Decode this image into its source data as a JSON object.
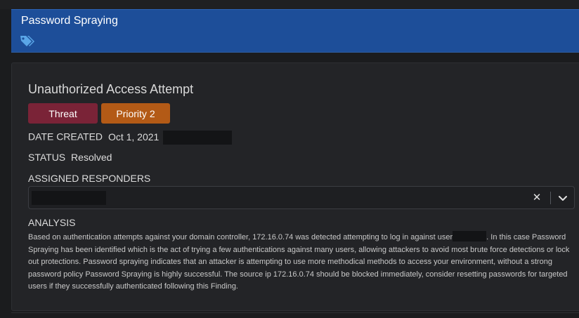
{
  "header": {
    "title": "Password Spraying",
    "tags_icon": "tags-icon",
    "color": "#1d4e99"
  },
  "finding": {
    "title": "Unauthorized Access Attempt",
    "badges": {
      "threat": "Threat",
      "priority": "Priority 2"
    },
    "date_created_label": "DATE CREATED",
    "date_created_value": "Oct 1, 2021",
    "status_label": "STATUS",
    "status_value": "Resolved",
    "assigned_label": "ASSIGNED RESPONDERS",
    "analysis_label": "ANALYSIS",
    "analysis_part1": "Based on authentication attempts against your domain controller, 172.16.0.74 was detected attempting to log in against user",
    "analysis_part2": ". In this case Password Spraying has been identified which is the act of trying a few authentications against many users, allowing attackers to avoid most brute force detections or lock out protections. Password spraying indicates that an attacker is attempting to use more methodical methods to access your environment, without a strong password policy Password Spraying is highly successful. The source ip 172.16.0.74 should be blocked immediately, consider resetting passwords for targeted users if they successfully authenticated following this Finding."
  },
  "colors": {
    "threat": "#7a2337",
    "priority": "#b35a16",
    "background": "#1b1c1e",
    "card": "#232427"
  },
  "icons": {
    "clear": "close-icon",
    "dropdown": "chevron-down-icon"
  }
}
